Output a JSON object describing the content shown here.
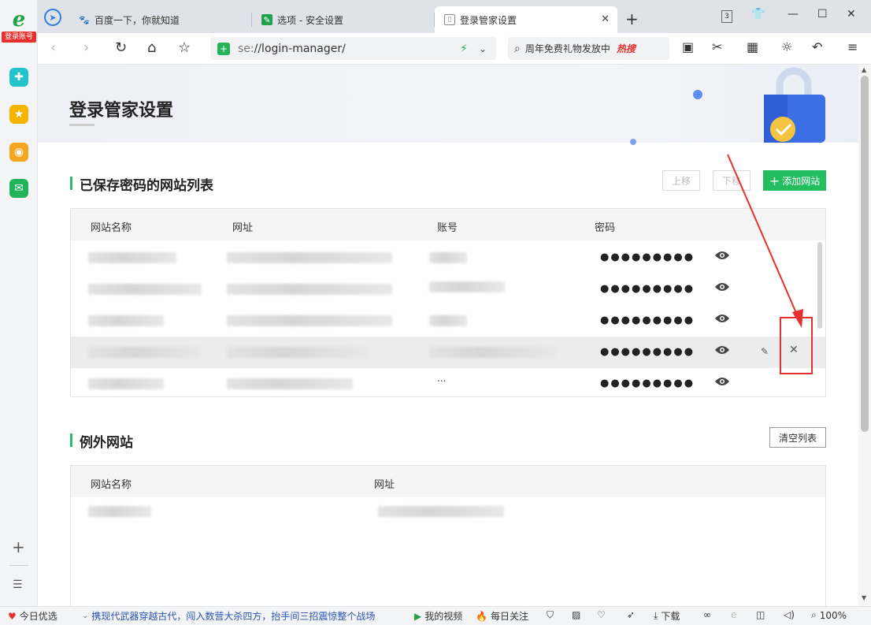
{
  "sidebar": {
    "logo_badge": "登录账号"
  },
  "tabs": [
    {
      "label": "百度一下，你就知道"
    },
    {
      "label": "选项 - 安全设置"
    },
    {
      "label": "登录管家设置"
    }
  ],
  "toolbar": {
    "url_prefix": "se:",
    "url_rest": "//login-manager/",
    "search_text": "周年免费礼物发放中",
    "hot_label": "热搜"
  },
  "window": {
    "tab_count": "3"
  },
  "page": {
    "title": "登录管家设置",
    "saved_section_title": "已保存密码的网站列表",
    "btn_up": "上移",
    "btn_down": "下移",
    "btn_add": "添加网站",
    "headers": {
      "name": "网站名称",
      "url": "网址",
      "account": "账号",
      "password": "密码"
    },
    "password_mask": "●●●●●●●●●",
    "row_ellipsis": "...",
    "exception_section_title": "例外网站",
    "btn_clear": "清空列表",
    "exception_headers": {
      "name": "网站名称",
      "url": "网址"
    }
  },
  "statusbar": {
    "today": "今日优选",
    "news": "携现代武器穿越古代，闯入数营大杀四方，抬手间三招震惊整个战场",
    "video": "我的视频",
    "follow": "每日关注",
    "download": "下载",
    "zoom": "100%"
  },
  "colors": {
    "accent_green": "#22be60",
    "annotation_red": "#e5302d",
    "link_blue": "#2e7de1"
  }
}
